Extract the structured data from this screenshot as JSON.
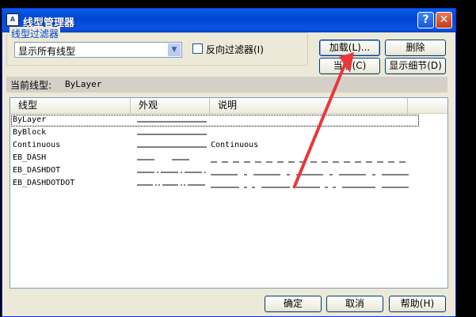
{
  "window": {
    "title": "线型管理器",
    "app_icon": "cad-icon",
    "help_label": "?",
    "close_label": "✕"
  },
  "filter": {
    "legend": "线型过滤器",
    "selected": "显示所有线型",
    "invert_label": "反向过滤器(I)",
    "invert_checked": false
  },
  "buttons": {
    "load": "加载(L)...",
    "delete": "删除",
    "current": "当前(C)",
    "details": "显示细节(D)",
    "ok": "确定",
    "cancel": "取消",
    "help": "帮助(H)"
  },
  "current_linetype": {
    "label": "当前线型:",
    "value": "ByLayer"
  },
  "table": {
    "columns": [
      "线型",
      "外观",
      "说明"
    ],
    "rows": [
      {
        "name": "ByLayer",
        "pattern": "solid",
        "description": "",
        "selected": true
      },
      {
        "name": "ByBlock",
        "pattern": "solid",
        "description": "",
        "selected": false
      },
      {
        "name": "Continuous",
        "pattern": "solid",
        "description": "Continuous",
        "selected": false
      },
      {
        "name": "EB_DASH",
        "pattern": "dash",
        "description": "",
        "selected": false
      },
      {
        "name": "EB_DASHDOT",
        "pattern": "dashdot",
        "description": "",
        "selected": false
      },
      {
        "name": "EB_DASHDOTDOT",
        "pattern": "dashdotdot",
        "description": "",
        "selected": false
      }
    ]
  },
  "colors": {
    "title_bar": "#0046d5",
    "dialog_bg": "#ece9d8",
    "annotation_arrow": "#e8383a"
  }
}
